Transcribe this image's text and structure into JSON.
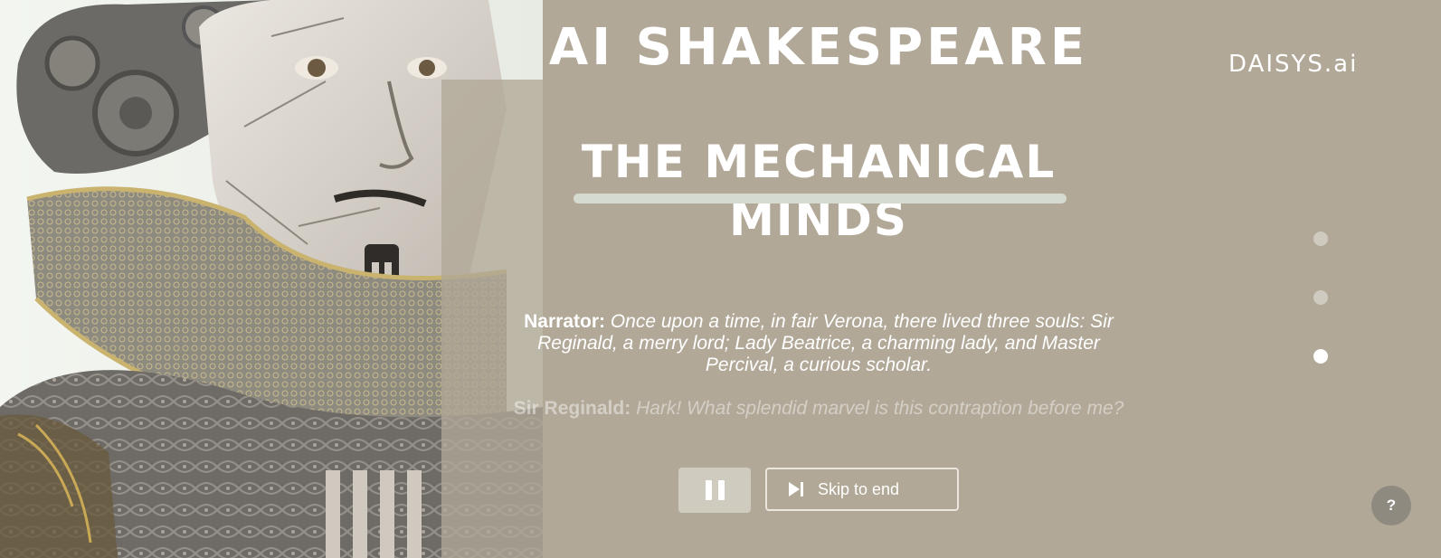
{
  "app": {
    "title": "AI SHAKESPEARE",
    "brand": "DAISYS.ai"
  },
  "story": {
    "title": "THE MECHANICAL MINDS",
    "progress": {
      "total_steps": 3,
      "current_step": 3
    }
  },
  "dialogue": [
    {
      "speaker": "Narrator:",
      "line": "Once upon a time, in fair Verona, there lived three souls: Sir Reginald, a merry lord; Lady Beatrice, a charming lady, and Master Percival, a curious scholar.",
      "state": "current"
    },
    {
      "speaker": "Sir Reginald:",
      "line": "Hark! What splendid marvel is this contraption before me?",
      "state": "upcoming"
    }
  ],
  "controls": {
    "pause_icon": "pause-icon",
    "skip_label": "Skip to end",
    "skip_icon": "skip-to-end-icon",
    "help_label": "?"
  },
  "colors": {
    "background": "#b1a897",
    "text": "#ffffff",
    "underline": "#d6dbd0",
    "pause_button": "#cfcbbf",
    "help_button": "#8f8a80"
  }
}
